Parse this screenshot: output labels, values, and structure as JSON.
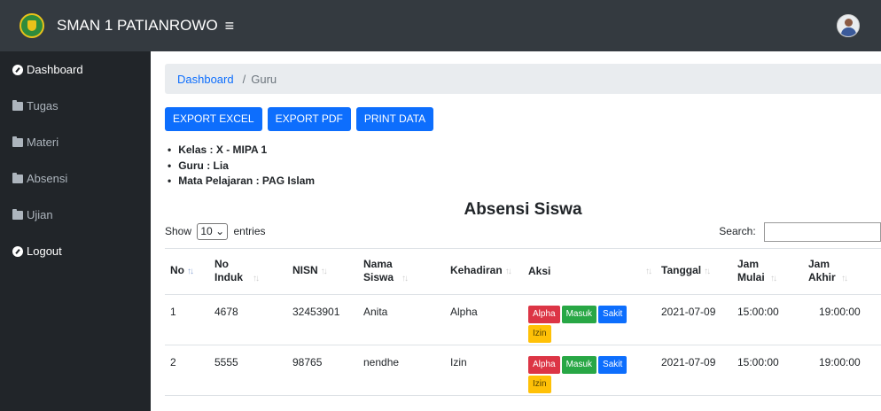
{
  "app": {
    "brand": "SMAN 1 PATIANROWO",
    "toggle_icon": "≡"
  },
  "sidebar": {
    "items": [
      {
        "label": "Dashboard",
        "icon": "tachometer-icon"
      },
      {
        "label": "Tugas",
        "icon": "folder-icon"
      },
      {
        "label": "Materi",
        "icon": "folder-icon"
      },
      {
        "label": "Absensi",
        "icon": "folder-icon"
      },
      {
        "label": "Ujian",
        "icon": "folder-icon"
      },
      {
        "label": "Logout",
        "icon": "tachometer-icon"
      }
    ]
  },
  "breadcrumb": {
    "home": "Dashboard",
    "separator": "/",
    "current": "Guru"
  },
  "actions": {
    "export_excel": "EXPORT EXCEL",
    "export_pdf": "EXPORT PDF",
    "print": "PRINT DATA"
  },
  "info": {
    "kelas": "Kelas : X - MIPA 1",
    "guru": "Guru : Lia",
    "mapel": "Mata Pelajaran : PAG Islam"
  },
  "table_title": "Absensi Siswa",
  "controls": {
    "show": "Show",
    "length": "10",
    "entries": "entries",
    "search_label": "Search:"
  },
  "columns": [
    "No",
    "No Induk",
    "NISN",
    "Nama Siswa",
    "Kehadiran",
    "Aksi",
    "Tanggal",
    "Jam Mulai",
    "Jam Akhir"
  ],
  "aksi_labels": {
    "alpha": "Alpha",
    "masuk": "Masuk",
    "sakit": "Sakit",
    "izin": "Izin"
  },
  "rows": [
    {
      "no": "1",
      "no_induk": "4678",
      "nisn": "32453901",
      "nama": "Anita",
      "kehadiran": "Alpha",
      "tanggal": "2021-07-09",
      "jam_mulai": "15:00:00",
      "jam_akhir": "19:00:00"
    },
    {
      "no": "2",
      "no_induk": "5555",
      "nisn": "98765",
      "nama": "nendhe",
      "kehadiran": "Izin",
      "tanggal": "2021-07-09",
      "jam_mulai": "15:00:00",
      "jam_akhir": "19:00:00"
    }
  ],
  "colors": {
    "topbar": "#343a40",
    "sidebar": "#212529",
    "primary": "#0d6efd",
    "danger": "#dc3545",
    "success": "#28a745",
    "warning": "#ffc107"
  }
}
